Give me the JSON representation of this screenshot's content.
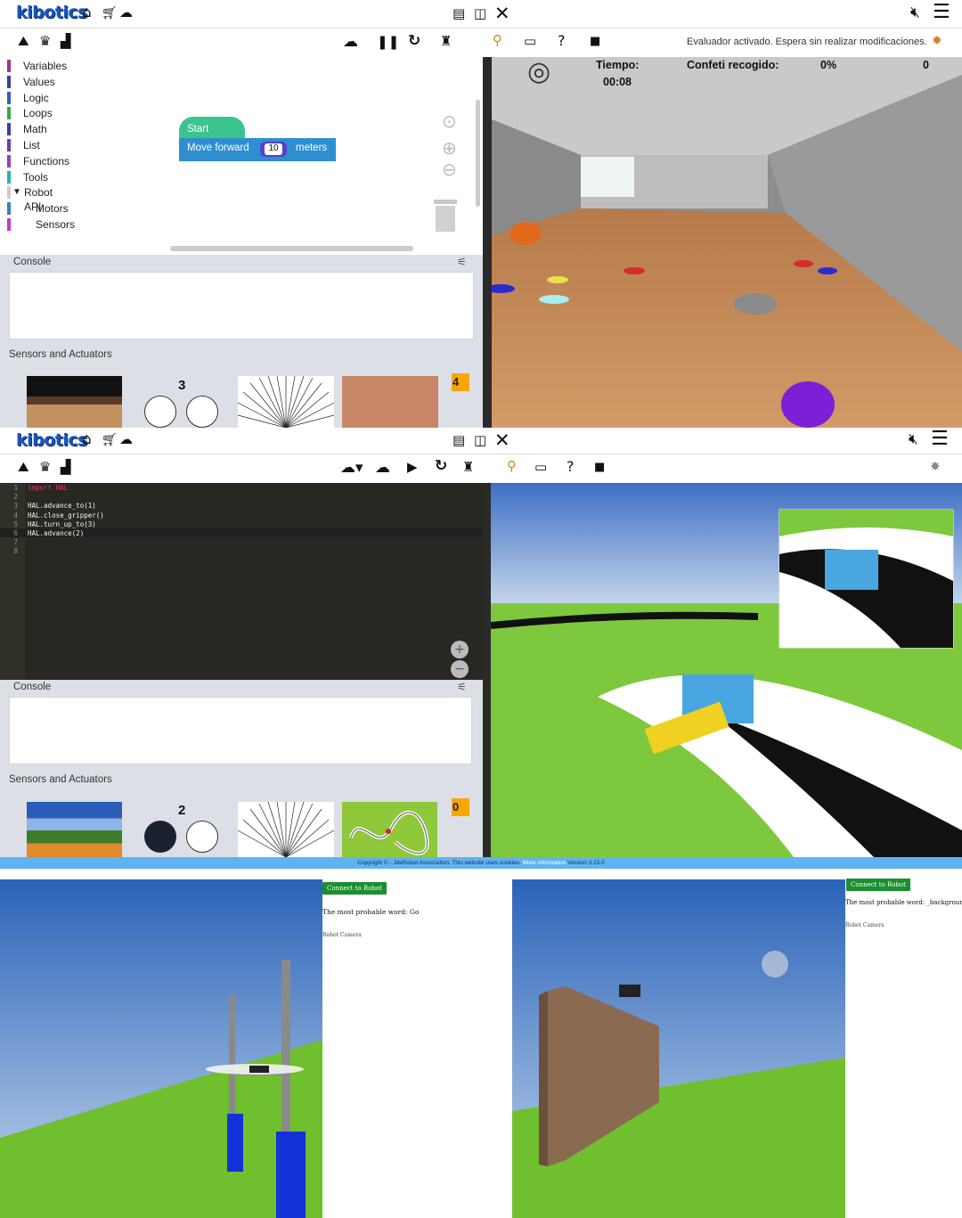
{
  "app": {
    "logo": "kibotics"
  },
  "top_section": {
    "status_message": "Evaluador activado. Espera sin realizar modificaciones.",
    "blockly_categories": [
      {
        "label": "Variables",
        "color": "#a5348f"
      },
      {
        "label": "Values",
        "color": "#3a3fa6"
      },
      {
        "label": "Logic",
        "color": "#2f5fb8"
      },
      {
        "label": "Loops",
        "color": "#35a845"
      },
      {
        "label": "Math",
        "color": "#3a3fa6"
      },
      {
        "label": "List",
        "color": "#6b3fae"
      },
      {
        "label": "Functions",
        "color": "#9c3fb0"
      },
      {
        "label": "Tools",
        "color": "#28b2b2"
      },
      {
        "label": "Robot API",
        "color": "#cccccc"
      },
      {
        "label": "Motors",
        "color": "#2f7fd0"
      },
      {
        "label": "Sensors",
        "color": "#c23bc3"
      }
    ],
    "blocks": {
      "start_label": "Start",
      "move_label": "Move forward",
      "move_value": "10",
      "move_unit": "meters"
    },
    "console_label": "Console",
    "sensors_label": "Sensors and Actuators",
    "ultrasound_count": "3",
    "score_badge": "4",
    "hud": {
      "time_label": "Tiempo:",
      "time_value": "00:08",
      "confetti_label": "Confeti recogido:",
      "confetti_percent": "0%",
      "confetti_count": "0"
    }
  },
  "middle_section": {
    "code_lines": [
      {
        "num": "1",
        "text": "import HAL",
        "kind": "import"
      },
      {
        "num": "2",
        "text": "",
        "kind": "plain"
      },
      {
        "num": "3",
        "text": "HAL.advance_to(1)",
        "kind": "call"
      },
      {
        "num": "4",
        "text": "HAL.close_gripper()",
        "kind": "call"
      },
      {
        "num": "5",
        "text": "HAL.turn_up_to(3)",
        "kind": "call"
      },
      {
        "num": "6",
        "text": "HAL.advance(2)",
        "kind": "call"
      },
      {
        "num": "7",
        "text": "",
        "kind": "plain"
      },
      {
        "num": "8",
        "text": "",
        "kind": "plain"
      }
    ],
    "console_label": "Console",
    "sensors_label": "Sensors and Actuators",
    "ultrasound_count": "2",
    "score_badge": "0",
    "footer": {
      "copyright": "Copyright © - JdeRobot Association. This website uses cookies.",
      "more_info": "More information",
      "version": "Version 3.15.0"
    }
  },
  "bottom_left": {
    "connect_button": "Connect to Robot",
    "prediction": "The most probable word: Go",
    "camera_label": "Robot Camera"
  },
  "bottom_right": {
    "connect_button": "Connect to Robot",
    "prediction": "The most probable word: _background_noise_",
    "camera_label": "Robot Camera"
  }
}
